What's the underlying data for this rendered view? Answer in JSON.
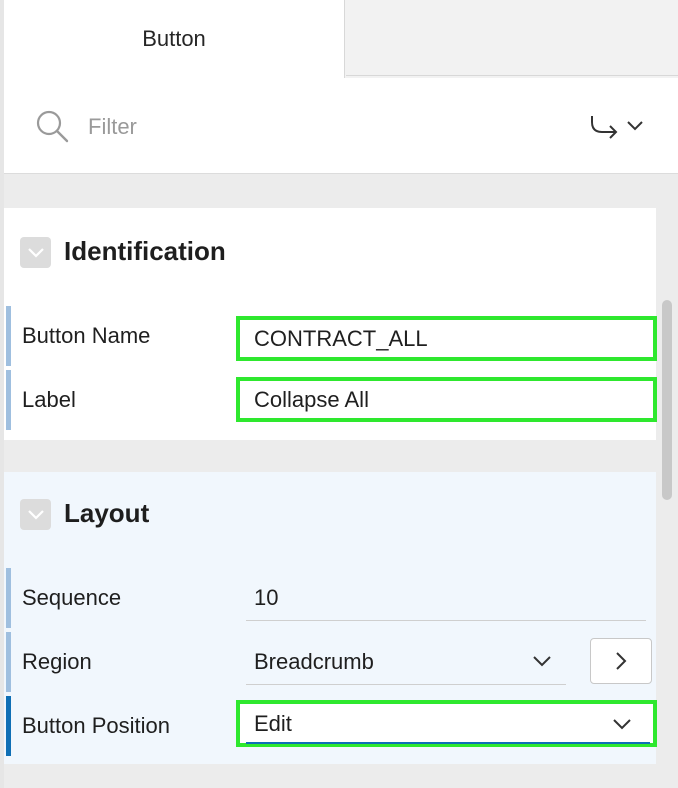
{
  "tabs": [
    {
      "label": "Button"
    }
  ],
  "filter": {
    "placeholder": "Filter"
  },
  "icons": [
    "search-icon",
    "goto-arrow-icon",
    "chevron-down-icon",
    "chevron-right-icon"
  ],
  "colors": {
    "highlight": "#2ee82e",
    "active_marker": "#0f6fb5",
    "marker": "#9fbfdf",
    "layout_bg": "#f1f7fd"
  },
  "identification": {
    "title": "Identification",
    "button_name": {
      "label": "Button Name",
      "value": "CONTRACT_ALL"
    },
    "label": {
      "label": "Label",
      "value": "Collapse All"
    }
  },
  "layout": {
    "title": "Layout",
    "sequence": {
      "label": "Sequence",
      "value": "10"
    },
    "region": {
      "label": "Region",
      "value": "Breadcrumb"
    },
    "button_position": {
      "label": "Button Position",
      "value": "Edit"
    }
  }
}
